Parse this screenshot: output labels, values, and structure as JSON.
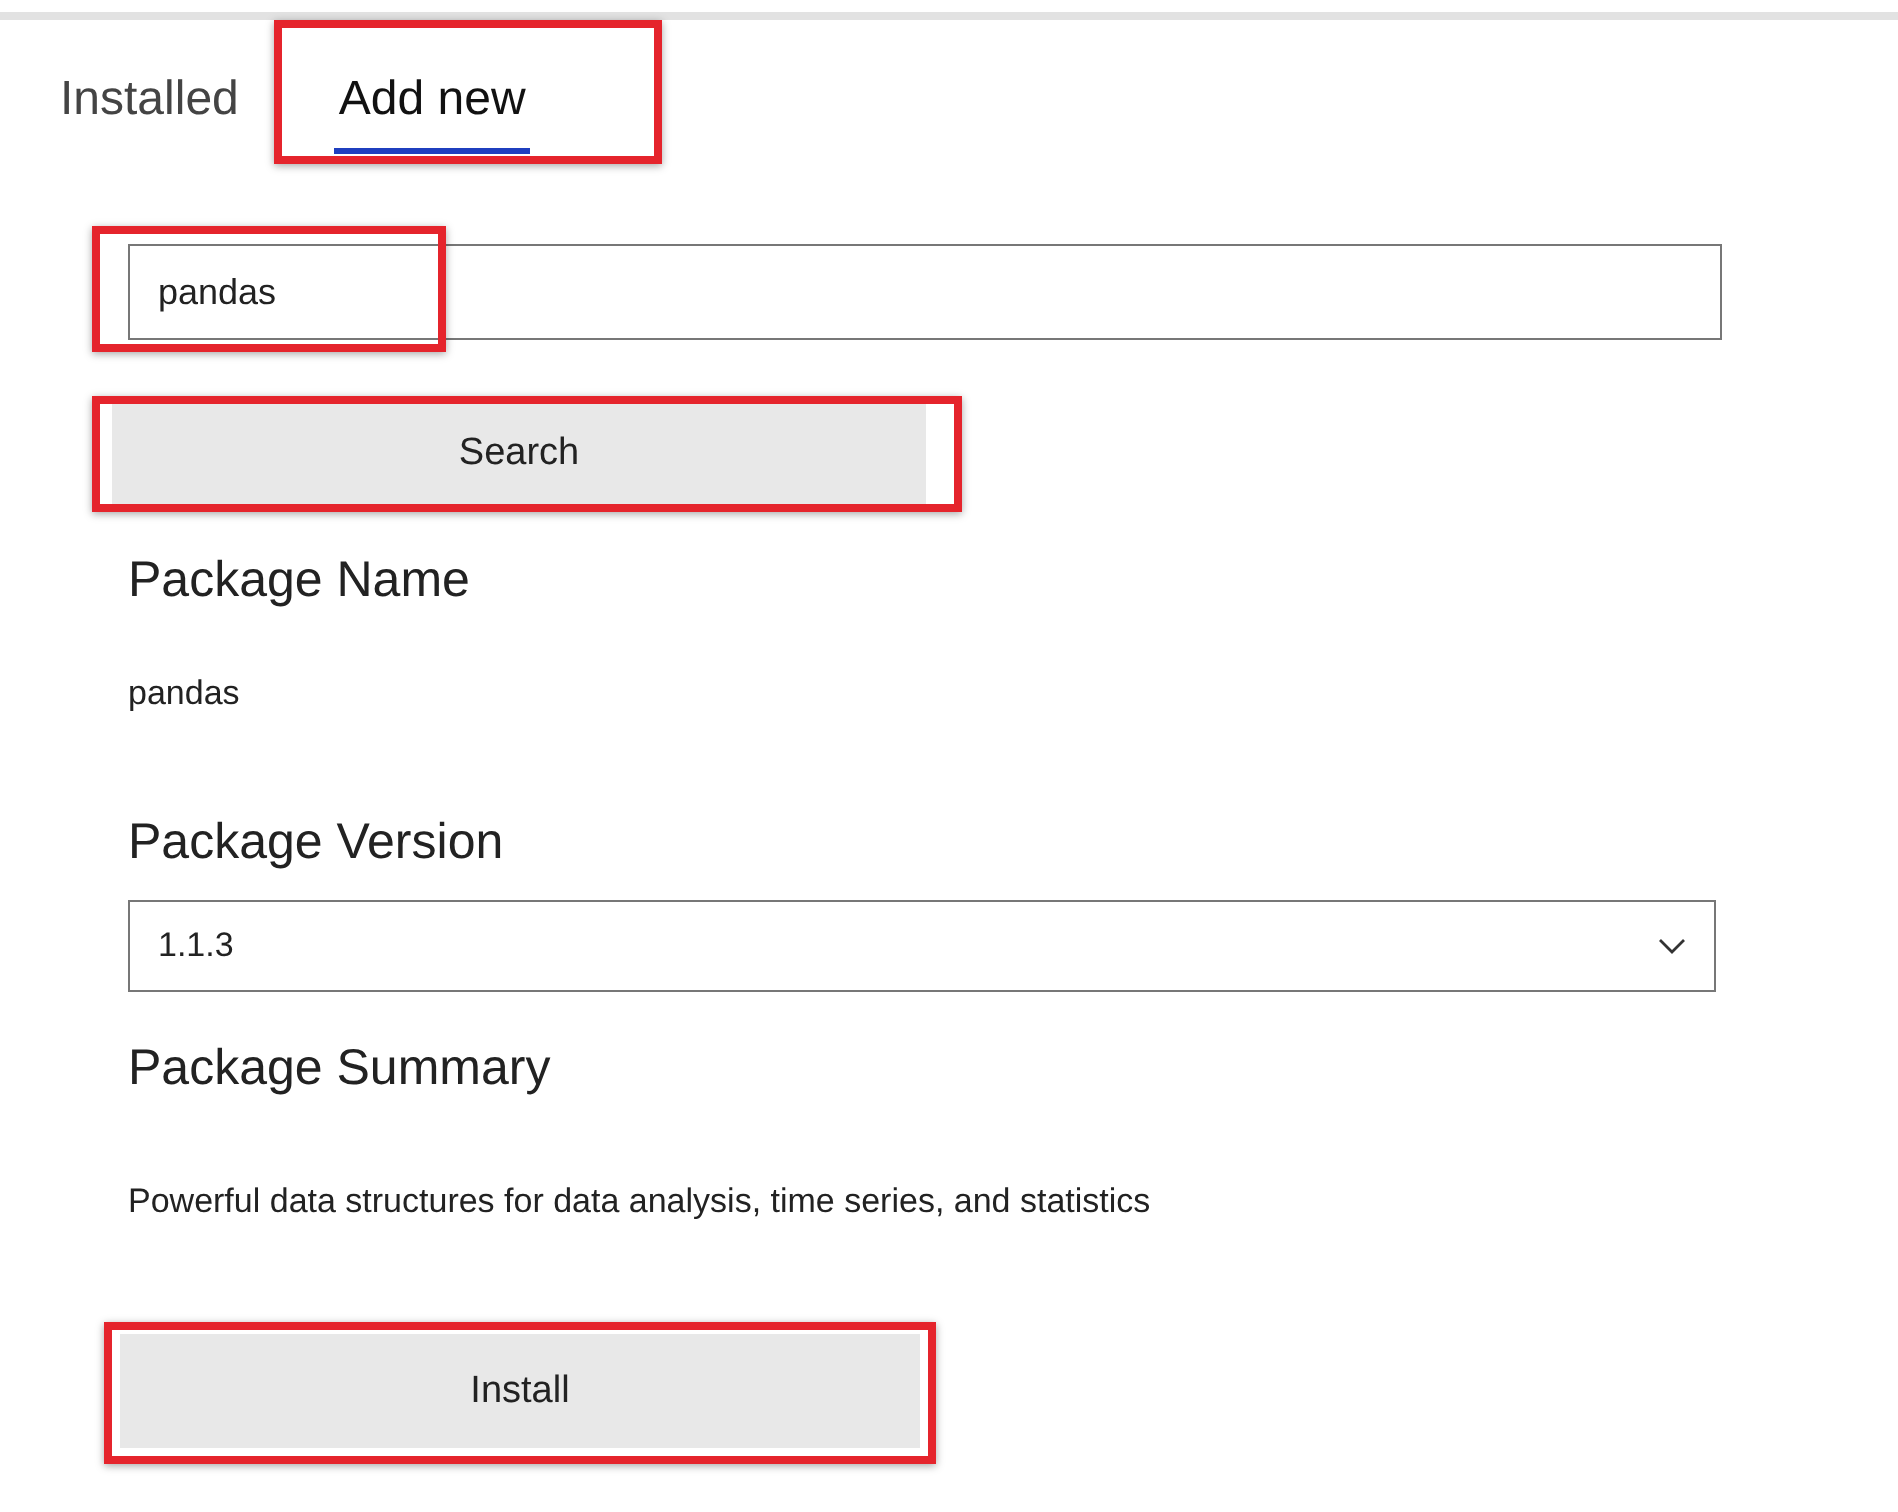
{
  "tabs": [
    {
      "label": "Installed",
      "selected": false,
      "highlighted": false
    },
    {
      "label": "Add new",
      "selected": true,
      "highlighted": true
    }
  ],
  "search": {
    "value": "pandas",
    "highlighted": true
  },
  "search_button": {
    "label": "Search",
    "highlighted": true
  },
  "package_name": {
    "label": "Package Name",
    "value": "pandas"
  },
  "package_version": {
    "label": "Package Version",
    "value": "1.1.3"
  },
  "package_summary": {
    "label": "Package Summary",
    "value": "Powerful data structures for data analysis, time series, and statistics"
  },
  "install_button": {
    "label": "Install",
    "highlighted": true
  }
}
